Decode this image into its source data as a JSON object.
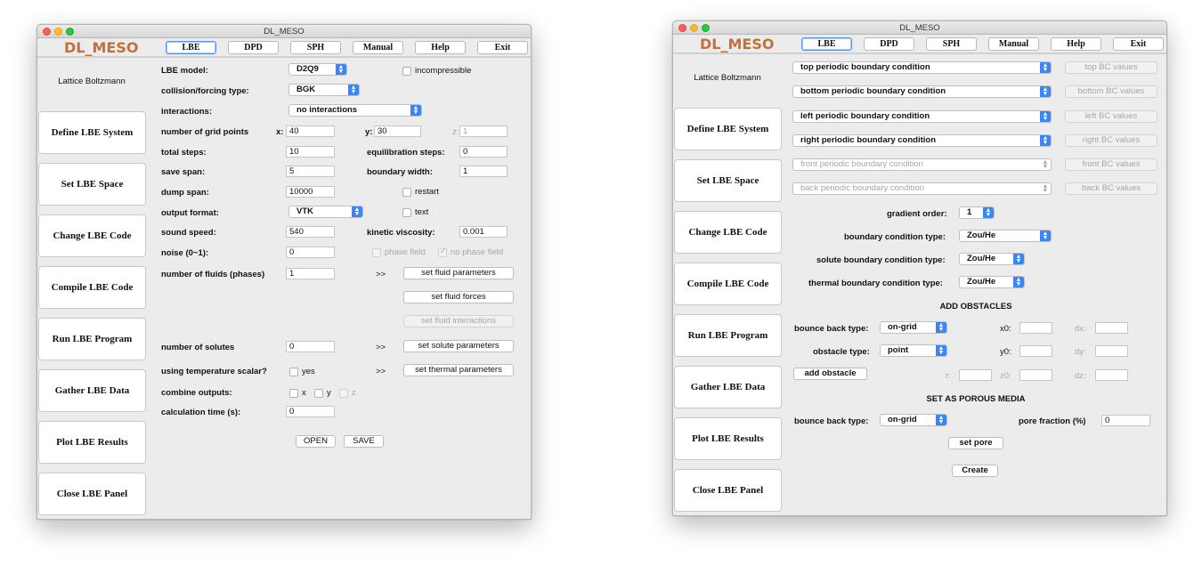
{
  "window_title": "DL_MESO",
  "brand": "DL_MESO",
  "nav": [
    "LBE",
    "DPD",
    "SPH",
    "Manual",
    "Help",
    "Exit"
  ],
  "sidebar": {
    "title": "Lattice Boltzmann",
    "buttons": [
      "Define LBE System",
      "Set LBE Space",
      "Change LBE Code",
      "Compile LBE Code",
      "Run LBE Program",
      "Gather LBE Data",
      "Plot LBE Results",
      "Close LBE Panel"
    ]
  },
  "system_panel": {
    "lbe_model": {
      "label": "LBE model:",
      "value": "D2Q9"
    },
    "incompressible": "incompressible",
    "collision": {
      "label": "collision/forcing type:",
      "value": "BGK"
    },
    "interactions": {
      "label": "interactions:",
      "value": "no interactions"
    },
    "grid": {
      "label": "number of grid points",
      "x_label": "x:",
      "x": "40",
      "y_label": "y:",
      "y": "30",
      "z_label": "z:",
      "z": "1"
    },
    "total_steps": {
      "label": "total steps:",
      "value": "10"
    },
    "equilibration_steps": {
      "label": "equilibration steps:",
      "value": "0"
    },
    "save_span": {
      "label": "save span:",
      "value": "5"
    },
    "boundary_width": {
      "label": "boundary width:",
      "value": "1"
    },
    "dump_span": {
      "label": "dump span:",
      "value": "10000"
    },
    "restart": "restart",
    "output_format": {
      "label": "output format:",
      "value": "VTK"
    },
    "text_option": "text",
    "sound_speed": {
      "label": "sound speed:",
      "value": "540"
    },
    "kinetic_viscosity": {
      "label": "kinetic viscosity:",
      "value": "0.001"
    },
    "noise": {
      "label": "noise (0~1):",
      "value": "0"
    },
    "phase_field": "phase field",
    "no_phase_field": "no phase field",
    "fluids": {
      "label": "number of fluids (phases)",
      "value": "1"
    },
    "chevrons": ">>",
    "set_fluid_parameters": "set fluid parameters",
    "set_fluid_forces": "set fluid forces",
    "set_fluid_interactions": "set fluid interactions",
    "solutes": {
      "label": "number of solutes",
      "value": "0"
    },
    "set_solute_parameters": "set solute parameters",
    "temperature": {
      "label": "using temperature scalar?",
      "yes": "yes"
    },
    "set_thermal_parameters": "set thermal parameters",
    "combine": {
      "label": "combine outputs:",
      "x": "x",
      "y": "y",
      "z": "z"
    },
    "calc_time": {
      "label": "calculation time (s):",
      "value": "0"
    },
    "open": "OPEN",
    "save": "SAVE"
  },
  "space_panel": {
    "boundaries": [
      {
        "select": "top periodic boundary condition",
        "button": "top BC values",
        "enabled": true
      },
      {
        "select": "bottom periodic boundary condition",
        "button": "bottom BC values",
        "enabled": true
      },
      {
        "select": "left periodic boundary condition",
        "button": "left BC values",
        "enabled": true
      },
      {
        "select": "right periodic boundary condition",
        "button": "right BC values",
        "enabled": true
      },
      {
        "select": "front periodic boundary condition",
        "button": "front BC values",
        "enabled": false
      },
      {
        "select": "back periodic boundary condition",
        "button": "back BC values",
        "enabled": false
      }
    ],
    "gradient_order": {
      "label": "gradient order:",
      "value": "1"
    },
    "bc_type": {
      "label": "boundary condition type:",
      "value": "Zou/He"
    },
    "solute_bc_type": {
      "label": "solute boundary condition type:",
      "value": "Zou/He"
    },
    "thermal_bc_type": {
      "label": "thermal boundary condition type:",
      "value": "Zou/He"
    },
    "add_obstacles": "ADD OBSTACLES",
    "bounce_back": {
      "label": "bounce back type:",
      "value": "on-grid"
    },
    "obstacle_type": {
      "label": "obstacle type:",
      "value": "point"
    },
    "add_obstacle": "add obstacle",
    "coords": {
      "x0": "x0:",
      "dx": "dx:",
      "y0": "y0:",
      "dy": "dy:",
      "r": "r:",
      "z0": "z0:",
      "dz": "dz:"
    },
    "porous": "SET AS POROUS MEDIA",
    "porous_bounce_back": {
      "label": "bounce back type:",
      "value": "on-grid"
    },
    "pore_fraction": {
      "label": "pore fraction (%)",
      "value": "0"
    },
    "set_pore": "set pore",
    "create": "Create"
  }
}
